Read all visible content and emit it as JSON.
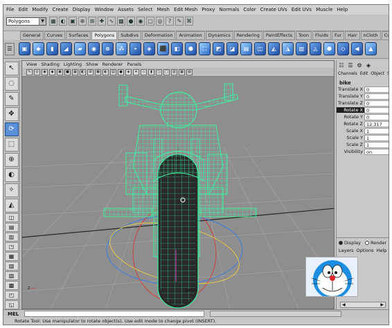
{
  "menubar": [
    "File",
    "Edit",
    "Modify",
    "Create",
    "Display",
    "Window",
    "Assets",
    "Select",
    "Mesh",
    "Edit Mesh",
    "Proxy",
    "Normals",
    "Color",
    "Create UVs",
    "Edit UVs",
    "Muscle",
    "Help"
  ],
  "status": {
    "mode": "Polygons",
    "icons": [
      "folder-icon",
      "save-icon",
      "camera-icon",
      "magnet-icon",
      "select-icon",
      "move-icon",
      "curve-icon",
      "grid-icon",
      "render-icon",
      "hypershade-icon",
      "snapshot-icon",
      "sphere-icon",
      "question-icon",
      "paint-icon",
      "magnet2-icon"
    ],
    "glyphs": [
      "▦",
      "◐",
      "▣",
      "⊕",
      "⊞",
      "✚",
      "∿",
      "▩",
      "●",
      "◉",
      "▢",
      "◎",
      "?",
      "✎",
      "⌘"
    ]
  },
  "shelf_tabs": [
    {
      "label": "General",
      "active": false
    },
    {
      "label": "Curves",
      "active": false
    },
    {
      "label": "Surfaces",
      "active": false
    },
    {
      "label": "Polygons",
      "active": true
    },
    {
      "label": "Subdivs",
      "active": false
    },
    {
      "label": "Deformation",
      "active": false
    },
    {
      "label": "Animation",
      "active": false
    },
    {
      "label": "Dynamics",
      "active": false
    },
    {
      "label": "Rendering",
      "active": false
    },
    {
      "label": "PaintEffects",
      "active": false
    },
    {
      "label": "Toon",
      "active": false
    },
    {
      "label": "Fluids",
      "active": false
    },
    {
      "label": "Fur",
      "active": false
    },
    {
      "label": "Hair",
      "active": false
    },
    {
      "label": "nCloth",
      "active": false
    },
    {
      "label": "Custom",
      "active": false
    }
  ],
  "shelf_icons": [
    "▣",
    "◆",
    "▮",
    "◢",
    "▰",
    "◉",
    "⊗",
    "⁂",
    "⌖",
    "◈",
    "⬛",
    "◧",
    "⬢",
    "⛶",
    "◩",
    "◪",
    "▤",
    "◫",
    "◭",
    "◮",
    "▥",
    "◬",
    "⬣",
    "◇",
    "◀",
    "▲"
  ],
  "tools": [
    {
      "name": "select-tool",
      "glyph": "↖",
      "active": false
    },
    {
      "name": "lasso-tool",
      "glyph": "◌",
      "active": false
    },
    {
      "name": "paint-select-tool",
      "glyph": "✎",
      "active": false
    },
    {
      "name": "move-tool",
      "glyph": "✥",
      "active": false
    },
    {
      "name": "rotate-tool",
      "glyph": "⟳",
      "active": true
    },
    {
      "name": "scale-tool",
      "glyph": "⬚",
      "active": false
    },
    {
      "name": "manipulator-tool",
      "glyph": "⊕",
      "active": false
    },
    {
      "name": "soft-mod-tool",
      "glyph": "◐",
      "active": false
    },
    {
      "name": "show-manipulator-tool",
      "glyph": "✧",
      "active": false
    },
    {
      "name": "last-tool",
      "glyph": "◭",
      "active": false
    }
  ],
  "layout_tools": [
    "◫",
    "▤",
    "▥",
    "◳",
    "▦",
    "▧",
    "▨",
    "▩",
    "◰",
    "◱",
    "◲",
    "▣"
  ],
  "viewport": {
    "menus": [
      "View",
      "Shading",
      "Lighting",
      "Show",
      "Renderer",
      "Panels"
    ],
    "toolbar_glyphs": [
      "✎",
      "◎",
      "◉",
      "◆",
      "▣",
      "■",
      "▦",
      "◧",
      "⊞",
      "▩",
      "◐",
      "▤",
      "●",
      "◈",
      "✦",
      "◇",
      "▮",
      "◫",
      "□",
      "▥",
      "▦",
      "▧"
    ],
    "camera_label": "persp",
    "axis_label": "z"
  },
  "channelbox": {
    "menus": [
      "Channels",
      "Edit",
      "Object",
      "Sh"
    ],
    "object": "bike",
    "attrs": [
      {
        "name": "Translate X",
        "value": "0",
        "highlight": false
      },
      {
        "name": "Translate Y",
        "value": "0",
        "highlight": false
      },
      {
        "name": "Translate Z",
        "value": "0",
        "highlight": false
      },
      {
        "name": "Rotate X",
        "value": "0",
        "highlight": true
      },
      {
        "name": "Rotate Y",
        "value": "0",
        "highlight": false
      },
      {
        "name": "Rotate Z",
        "value": "12.317",
        "highlight": false
      },
      {
        "name": "Scale X",
        "value": "1",
        "highlight": false
      },
      {
        "name": "Scale Y",
        "value": "1",
        "highlight": false
      },
      {
        "name": "Scale Z",
        "value": "1",
        "highlight": false
      },
      {
        "name": "Visibility",
        "value": "on",
        "highlight": false
      }
    ]
  },
  "layers": {
    "display_label": "Display",
    "render_label": "Render",
    "menus": [
      "Layers",
      "Options",
      "Help"
    ]
  },
  "commandline": {
    "mel_label": "MEL"
  },
  "help_text": "Rotate Tool: Use manipulator to rotate object(s). Use edit mode to change pivot (INSERT).",
  "colors": {
    "wireframe": "#3cf0a0",
    "viewport": "#8e8e8e",
    "tire": "#2a2a2a",
    "accent": "#5b8fd8"
  }
}
